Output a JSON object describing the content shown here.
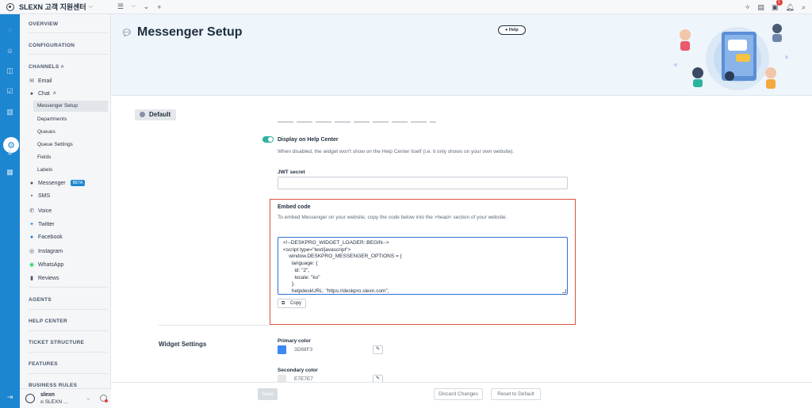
{
  "topbar": {
    "brand": "SLEXN 고객 지원센터",
    "tools": [
      "list-icon",
      "chevron-down-icon",
      "chevron-down-large-icon",
      "plus-icon"
    ],
    "notification_count": "1"
  },
  "nav": {
    "sections": {
      "overview": "OVERVIEW",
      "configuration": "CONFIGURATION",
      "channels": "CHANNELS",
      "agents": "AGENTS",
      "help_center": "HELP CENTER",
      "ticket_structure": "TICKET STRUCTURE",
      "features": "FEATURES",
      "business_rules": "BUSINESS RULES"
    },
    "items": {
      "email": "Email",
      "chat": "Chat",
      "messenger_setup": "Messenger Setup",
      "departments": "Departments",
      "queues": "Queues",
      "queue_settings": "Queue Settings",
      "fields": "Fields",
      "labels": "Labels",
      "messenger": "Messenger",
      "beta": "BETA",
      "sms": "SMS",
      "voice": "Voice",
      "twitter": "Twitter",
      "facebook": "Facebook",
      "instagram": "Instagram",
      "whatsapp": "WhatsApp",
      "reviews": "Reviews"
    },
    "user": {
      "name": "slexn",
      "org": "SLEXN ..."
    }
  },
  "page": {
    "title": "Messenger Setup",
    "help_label": "Help",
    "tab_label": "Default"
  },
  "form": {
    "display_help_center_label": "Display on Help Center",
    "display_help_center_help": "When disabled, the widget won't show on the Help Center itself (i.e. it only shows on your own website).",
    "jwt_label": "JWT secret",
    "jwt_value": "",
    "embed_label": "Embed code",
    "embed_help": "To embed Messenger on your website, copy the code below into the >head< section of your website.",
    "embed_code": "<!--DESKPRO_WIDGET_LOADER::BEGIN-->\n<script type=\"text/javascript\">\n    window.DESKPRO_MESSENGER_OPTIONS = {\n      language: {\n        id: \"2\",\n        locale: \"ko\"\n      },\n      helpdeskURL: \"https://deskpro.slexn.com\",",
    "copy_label": "Copy",
    "widget_settings_title": "Widget Settings",
    "primary_color_label": "Primary color",
    "primary_color_value": "3D88F3",
    "primary_color": "#3D88F3",
    "secondary_color_label": "Secondary color",
    "secondary_color_value": "E7E7E7",
    "secondary_color": "#E7E7E7"
  },
  "footer": {
    "save": "Save",
    "discard": "Discard Changes",
    "reset": "Reset to Default"
  }
}
